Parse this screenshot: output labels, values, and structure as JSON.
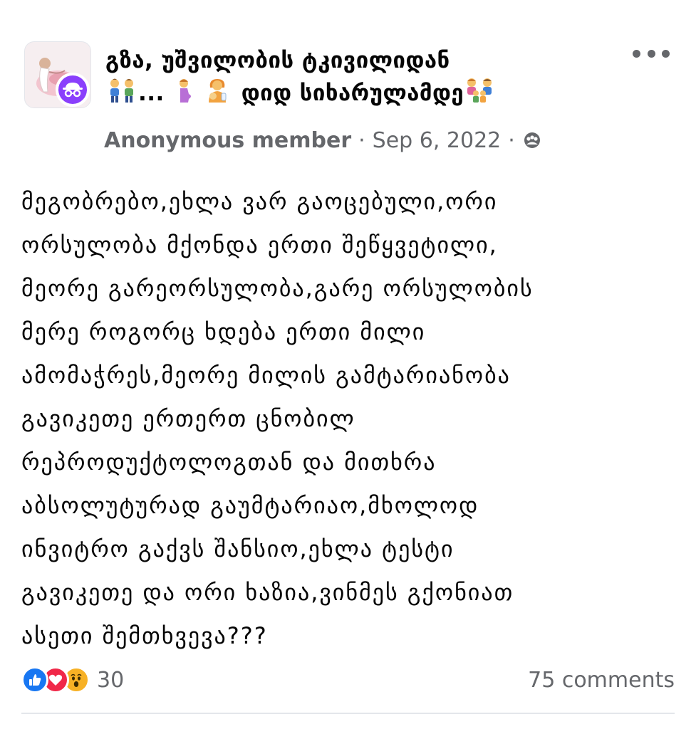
{
  "post": {
    "group_title": "გზა, უშვილობის ტკივილიდან",
    "group_title_line2": "...",
    "group_title_line3": "დიდ სიხარულამდე",
    "author": "Anonymous member",
    "date": "Sep 6, 2022",
    "separator": "·",
    "privacy_icon": "group-members-icon",
    "body_lines": [
      "მეგობრებო,ეხლა ვარ გაოცებული,ორი",
      "ორსულობა მქონდა ერთი შეწყვეტილი,",
      "მეორე გარეორსულობა,გარე ორსულობის",
      "მერე როგორც ხდება ერთი მილი",
      "ამომაჭრეს,მეორე მილის გამტარიანობა",
      "გავიკეთე ერთერთ ცნობილ",
      "რეპროდუქტოლოგთან და მითხრა",
      "აბსოლუტურად გაუმტარიაო,მხოლოდ",
      "ინვიტრო გაქვს შანსიო,ეხლა ტესტი",
      "გავიკეთე და ორი ხაზია,ვინმეს გქონიათ",
      "ასეთი შემთხვევა???"
    ]
  },
  "footer": {
    "reactions": [
      "like",
      "love",
      "wow"
    ],
    "reaction_count": "30",
    "comments": "75 comments"
  },
  "colors": {
    "text": "#050505",
    "secondary": "#65676b",
    "like": "#1877f2",
    "love": "#f02849",
    "wow": "#f7b125",
    "anonymous_badge": "#8a3ffc"
  }
}
